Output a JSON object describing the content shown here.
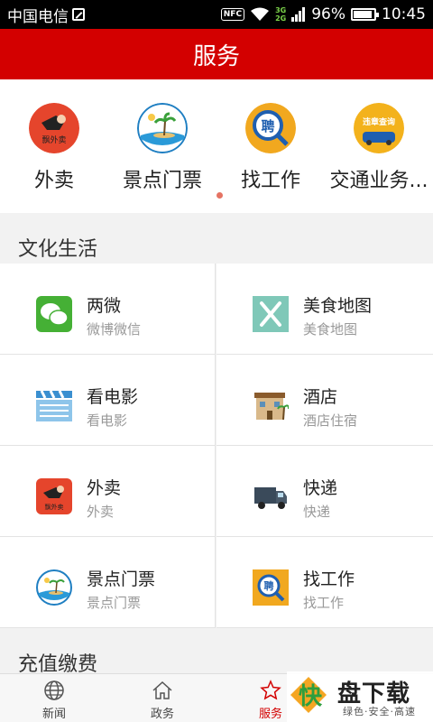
{
  "status_bar": {
    "carrier": "中国电信",
    "nfc": "NFC",
    "network_3g": "3G",
    "network_2g": "2G",
    "battery": "96%",
    "time": "10:45"
  },
  "header": {
    "title": "服务"
  },
  "quick_services": [
    {
      "label": "外卖",
      "icon": "takeout-icon"
    },
    {
      "label": "景点门票",
      "icon": "scenic-ticket-icon"
    },
    {
      "label": "找工作",
      "icon": "job-search-icon"
    },
    {
      "label": "交通业务...",
      "icon": "traffic-violation-icon",
      "icon_text": "违章查询"
    }
  ],
  "takeout_icon_text": "飘外卖",
  "job_icon_text": "聘",
  "sections": [
    {
      "title": "文化生活",
      "items": [
        {
          "name": "两微",
          "subtitle": "微博微信",
          "icon": "wechat-icon"
        },
        {
          "name": "美食地图",
          "subtitle": "美食地图",
          "icon": "food-map-icon"
        },
        {
          "name": "看电影",
          "subtitle": "看电影",
          "icon": "movie-clapper-icon"
        },
        {
          "name": "酒店",
          "subtitle": "酒店住宿",
          "icon": "hotel-icon"
        },
        {
          "name": "外卖",
          "subtitle": "外卖",
          "icon": "takeout-icon"
        },
        {
          "name": "快递",
          "subtitle": "快递",
          "icon": "delivery-truck-icon"
        },
        {
          "name": "景点门票",
          "subtitle": "景点门票",
          "icon": "scenic-ticket-icon"
        },
        {
          "name": "找工作",
          "subtitle": "找工作",
          "icon": "job-search-icon"
        }
      ]
    },
    {
      "title": "充值缴费"
    }
  ],
  "tabbar": [
    {
      "label": "新闻",
      "icon": "globe-icon"
    },
    {
      "label": "政务",
      "icon": "home-icon"
    },
    {
      "label": "服务",
      "icon": "star-icon",
      "active": true
    }
  ],
  "watermark": {
    "char": "快",
    "main": "盘下载",
    "sub": "绿色·安全·高速"
  },
  "colors": {
    "brand_red": "#d30000",
    "background": "#f2f2f2",
    "divider": "#e3e3e3",
    "subtext": "#999999"
  }
}
